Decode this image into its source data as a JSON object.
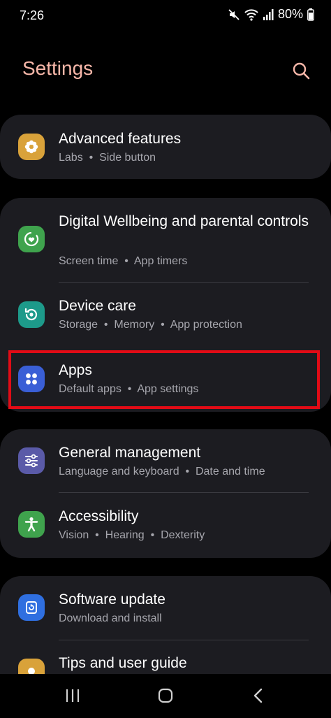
{
  "status_bar": {
    "time": "7:26",
    "battery": "80%"
  },
  "header": {
    "title": "Settings"
  },
  "items": {
    "advanced": {
      "title": "Advanced features",
      "subtitle": "Labs  •  Side button"
    },
    "wellbeing": {
      "title": "Digital Wellbeing and parental controls",
      "subtitle": "Screen time  •  App timers"
    },
    "device_care": {
      "title": "Device care",
      "subtitle": "Storage  •  Memory  •  App protection"
    },
    "apps": {
      "title": "Apps",
      "subtitle": "Default apps  •  App settings"
    },
    "general": {
      "title": "General management",
      "subtitle": "Language and keyboard  •  Date and time"
    },
    "accessibility": {
      "title": "Accessibility",
      "subtitle": "Vision  •  Hearing  •  Dexterity"
    },
    "software": {
      "title": "Software update",
      "subtitle": "Download and install"
    },
    "tips": {
      "title": "Tips and user guide"
    }
  },
  "icons": {
    "advanced": {
      "name": "gear-flower-icon",
      "color": "#d9a23a"
    },
    "wellbeing": {
      "name": "heart-ring-icon",
      "color": "#3fa34d"
    },
    "device_care": {
      "name": "refresh-ring-icon",
      "color": "#1d9a8a"
    },
    "apps": {
      "name": "four-dots-icon",
      "color": "#3a5fd6"
    },
    "general": {
      "name": "sliders-icon",
      "color": "#5a5aa8"
    },
    "accessibility": {
      "name": "accessibility-person-icon",
      "color": "#3fa34d"
    },
    "software": {
      "name": "update-icon",
      "color": "#2f6fe0"
    },
    "tips": {
      "name": "tips-bulb-icon",
      "color": "#d9a23a"
    }
  },
  "colors": {
    "background": "#000000",
    "card": "#1c1c21",
    "title_accent": "#f7b7a9",
    "subtitle": "#a6a6ad",
    "highlight": "#e10b16"
  }
}
